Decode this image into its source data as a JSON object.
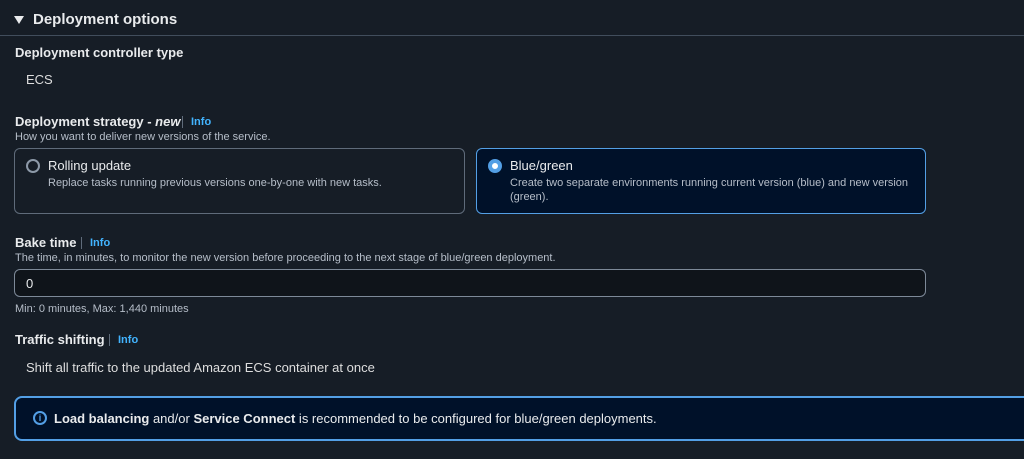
{
  "section": {
    "title": "Deployment options"
  },
  "controller": {
    "label": "Deployment controller type",
    "value": "ECS"
  },
  "strategy": {
    "label": "Deployment strategy - ",
    "label_suffix": "new",
    "info": "Info",
    "description": "How you want to deliver new versions of the service.",
    "options": [
      {
        "title": "Rolling update",
        "description": "Replace tasks running previous versions one-by-one with new tasks.",
        "selected": false
      },
      {
        "title": "Blue/green",
        "description": "Create two separate environments running current version (blue) and new version (green).",
        "selected": true
      }
    ]
  },
  "bake_time": {
    "label": "Bake time",
    "info": "Info",
    "description": "The time, in minutes, to monitor the new version before proceeding to the next stage of blue/green deployment.",
    "value": "0",
    "constraint": "Min: 0 minutes, Max: 1,440 minutes"
  },
  "traffic": {
    "label": "Traffic shifting",
    "info": "Info",
    "value": "Shift all traffic to the updated Amazon ECS container at once"
  },
  "alert": {
    "icon": "info-circle-icon",
    "bold1": "Load balancing",
    "text1": " and/or ",
    "bold2": "Service Connect",
    "text2": " is recommended to be configured for blue/green deployments."
  },
  "colors": {
    "background": "#161d26",
    "accent": "#539fe5",
    "link": "#42b4ff",
    "selected_bg": "#001129"
  }
}
